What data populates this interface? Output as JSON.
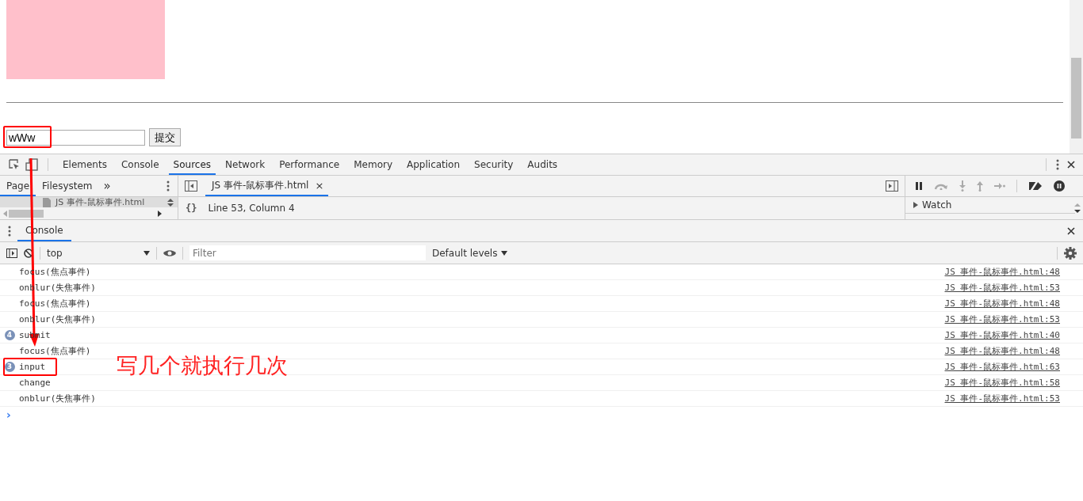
{
  "page": {
    "input": {
      "value": "wWw"
    },
    "submit_button": "提交"
  },
  "devtools": {
    "tabs": [
      {
        "label": "Elements",
        "selected": false
      },
      {
        "label": "Console",
        "selected": false
      },
      {
        "label": "Sources",
        "selected": true
      },
      {
        "label": "Network",
        "selected": false
      },
      {
        "label": "Performance",
        "selected": false
      },
      {
        "label": "Memory",
        "selected": false
      },
      {
        "label": "Application",
        "selected": false
      },
      {
        "label": "Security",
        "selected": false
      },
      {
        "label": "Audits",
        "selected": false
      }
    ],
    "navigator": {
      "tabs": [
        {
          "label": "Page",
          "selected": true
        },
        {
          "label": "Filesystem",
          "selected": false
        }
      ],
      "more": "»",
      "file": "JS 事件-鼠标事件.html"
    },
    "editor": {
      "file_tab": "JS 事件-鼠标事件.html",
      "close": "×",
      "format": "{}",
      "position": "Line 53, Column 4"
    },
    "debugger": {
      "watch": "Watch",
      "expanded": false
    },
    "drawer": {
      "tab": "Console"
    },
    "console": {
      "context": "top",
      "filter_placeholder": "Filter",
      "levels": "Default levels",
      "prompt": "›",
      "messages": [
        {
          "text": "focus(焦点事件)",
          "source": "JS 事件-鼠标事件.html:48"
        },
        {
          "text": "onblur(失焦事件)",
          "source": "JS 事件-鼠标事件.html:53"
        },
        {
          "text": "focus(焦点事件)",
          "source": "JS 事件-鼠标事件.html:48"
        },
        {
          "text": "onblur(失焦事件)",
          "source": "JS 事件-鼠标事件.html:53"
        },
        {
          "text": "submit",
          "count": "4",
          "source": "JS 事件-鼠标事件.html:40"
        },
        {
          "text": "focus(焦点事件)",
          "source": "JS 事件-鼠标事件.html:48"
        },
        {
          "text": "input",
          "count": "3",
          "source": "JS 事件-鼠标事件.html:63"
        },
        {
          "text": "change",
          "source": "JS 事件-鼠标事件.html:58"
        },
        {
          "text": "onblur(失焦事件)",
          "source": "JS 事件-鼠标事件.html:53"
        }
      ]
    }
  },
  "annotation": {
    "note": "写几个就执行几次"
  }
}
